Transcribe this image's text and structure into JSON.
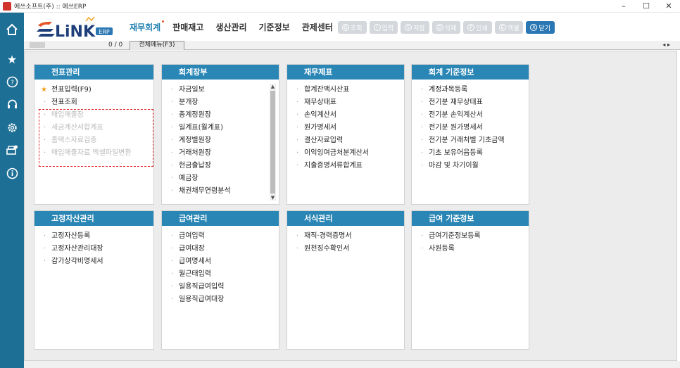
{
  "window": {
    "title": "에쓰소프트(주) :: 에쓰ERP",
    "controls": [
      "–",
      "☐",
      "✕"
    ]
  },
  "sidebar": {
    "icons": [
      "home-icon",
      "star-icon",
      "help-icon",
      "headset-icon",
      "gear-icon",
      "printer-settings-icon",
      "info-icon"
    ]
  },
  "header": {
    "logo_text": "LiNK",
    "logo_badge": "ERP",
    "menu": [
      "재무회계",
      "판매재고",
      "생산관리",
      "기준정보",
      "관제센터"
    ],
    "active_menu": "재무회계",
    "buttons": [
      {
        "key": "Q",
        "label": "조회"
      },
      {
        "key": "I",
        "label": "입력"
      },
      {
        "key": "S",
        "label": "저장"
      },
      {
        "key": "D",
        "label": "삭제"
      },
      {
        "key": "P",
        "label": "인쇄"
      },
      {
        "key": "E",
        "label": "엑셀"
      },
      {
        "key": "X",
        "label": "닫기"
      }
    ]
  },
  "tabbar": {
    "count": "0 / 0",
    "tab_label": "전체메뉴(F3)",
    "arrows": "◂ ▸"
  },
  "panels": [
    {
      "title": "전표관리",
      "items": [
        {
          "label": "전표입력(F9)",
          "star": true
        },
        {
          "label": "전표조회"
        },
        {
          "label": "매입매출장",
          "dim": true
        },
        {
          "label": "세금계산서합계표",
          "dim": true
        },
        {
          "label": "홈택스자료검증",
          "dim": true
        },
        {
          "label": "매입매출자료 엑셀파일변환",
          "dim": true
        }
      ]
    },
    {
      "title": "회계장부",
      "items": [
        {
          "label": "자금일보"
        },
        {
          "label": "분개장"
        },
        {
          "label": "총계정원장"
        },
        {
          "label": "일계표(월계표)"
        },
        {
          "label": "계정별원장"
        },
        {
          "label": "거래처원장"
        },
        {
          "label": "현금출납장"
        },
        {
          "label": "예금장"
        },
        {
          "label": "채권채무연령분석"
        }
      ]
    },
    {
      "title": "재무제표",
      "items": [
        {
          "label": "합계잔액시산표"
        },
        {
          "label": "재무상태표"
        },
        {
          "label": "손익계산서"
        },
        {
          "label": "원가명세서"
        },
        {
          "label": "결산자료입력"
        },
        {
          "label": "이익잉여금처분계산서"
        },
        {
          "label": "지출증명서류합계표"
        }
      ]
    },
    {
      "title": "회계 기준정보",
      "items": [
        {
          "label": "계정과목등록"
        },
        {
          "label": "전기분 재무상태표"
        },
        {
          "label": "전기분 손익계산서"
        },
        {
          "label": "전기분 원가명세서"
        },
        {
          "label": "전기분 거래처별 기초금액"
        },
        {
          "label": "기초 보유어음등록"
        },
        {
          "label": "마감 및 차기이월"
        }
      ]
    },
    {
      "title": "고정자산관리",
      "items": [
        {
          "label": "고정자산등록"
        },
        {
          "label": "고정자산관리대장"
        },
        {
          "label": "감가상각비명세서"
        }
      ]
    },
    {
      "title": "급여관리",
      "items": [
        {
          "label": "급여입력"
        },
        {
          "label": "급여대장"
        },
        {
          "label": "급여명세서"
        },
        {
          "label": "월근태입력"
        },
        {
          "label": "일용직급여입력"
        },
        {
          "label": "일용직급여대장"
        }
      ]
    },
    {
      "title": "서식관리",
      "items": [
        {
          "label": "재직·경력증명서"
        },
        {
          "label": "원천징수확인서"
        }
      ]
    },
    {
      "title": "급여 기준정보",
      "items": [
        {
          "label": "급여기준정보등록"
        },
        {
          "label": "사원등록"
        }
      ]
    }
  ]
}
